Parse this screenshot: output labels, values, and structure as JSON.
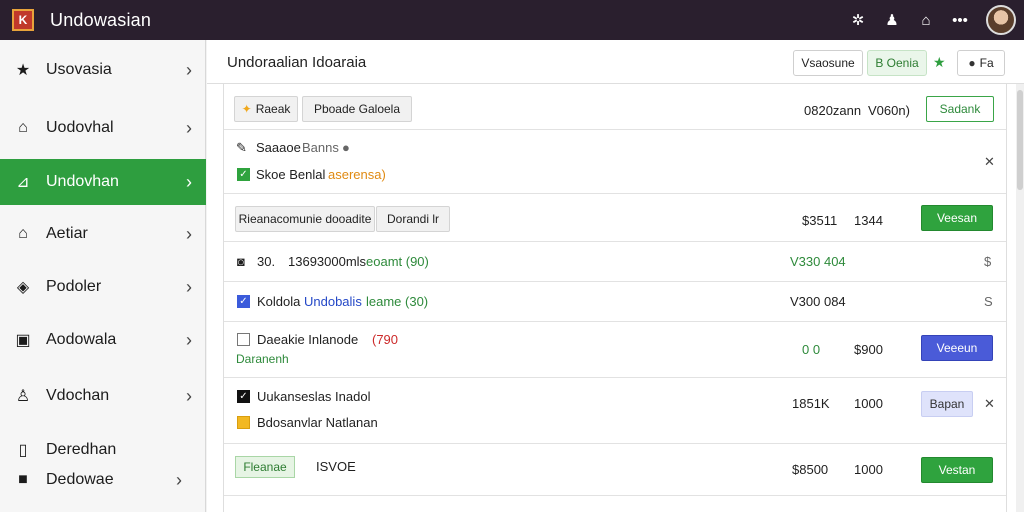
{
  "app": {
    "title": "Undowasian"
  },
  "topbar": {
    "icons": [
      "gear-icon",
      "user-icon",
      "home-icon",
      "more-icon",
      "avatar"
    ]
  },
  "sidebar": {
    "items": [
      {
        "label": "Usovasia",
        "icon": "star-icon"
      },
      {
        "label": "Uodovhal",
        "icon": "home-icon"
      },
      {
        "label": "Undovhan",
        "icon": "chart-icon",
        "active": true
      },
      {
        "label": "Aetiar",
        "icon": "home-outline-icon"
      },
      {
        "label": "Podoler",
        "icon": "tag-icon"
      },
      {
        "label": "Aodowala",
        "icon": "clipboard-icon"
      },
      {
        "label": "Vdochan",
        "icon": "user-icon"
      }
    ],
    "bottom": [
      {
        "label": "Deredhan",
        "icon": "tablet-icon"
      },
      {
        "label": "Dedowae",
        "icon": "box-icon"
      }
    ]
  },
  "header": {
    "title": "Undoraalian Idoaraia",
    "buttons": {
      "btn1": "Vsaosune",
      "btn2": "B Oenia",
      "btn3": "Fa"
    }
  },
  "rows": {
    "r1": {
      "chip1": "Raeak",
      "chip2": "Pboade Galoela",
      "meta1": "0820zann",
      "meta2": "V060n)",
      "button": "Sadank"
    },
    "r2": {
      "line1a": "Saaaoe",
      "line1b": "Banns",
      "line2a": "Skoe Benlal",
      "line2b": "aserensa)"
    },
    "r3": {
      "chip1": "Rieanacomunie dooadite",
      "chip2": "Dorandi lr",
      "meta1": "$3511",
      "meta2": "1344",
      "button": "Veesan"
    },
    "r4": {
      "code": "30.",
      "text": "13693000mls",
      "green": "eoamt (90)",
      "value": "V330 404",
      "right": "$"
    },
    "r5": {
      "text": "Koldola",
      "blue": "Undobalis",
      "green": "leame (30)",
      "value": "V300 084",
      "right": "S"
    },
    "r6": {
      "text": "Daeakie Inlanode",
      "red": "(790",
      "sub": "Daranenh",
      "meta1": "0 0",
      "meta2": "$900",
      "button": "Veeeun"
    },
    "r7": {
      "line1": "Uukanseslas Inadol",
      "line2": "Bdosanvlar Natlanan",
      "meta1": "1851K",
      "meta2": "1000",
      "button": "Bapan"
    },
    "r8": {
      "badge": "Fleanae",
      "text": "ISVOE",
      "meta1": "$8500",
      "meta2": "1000",
      "button": "Vestan"
    }
  },
  "colors": {
    "accent": "#2e9e3f",
    "topbar": "#2a1f2e",
    "blue": "#4a5bd8"
  }
}
